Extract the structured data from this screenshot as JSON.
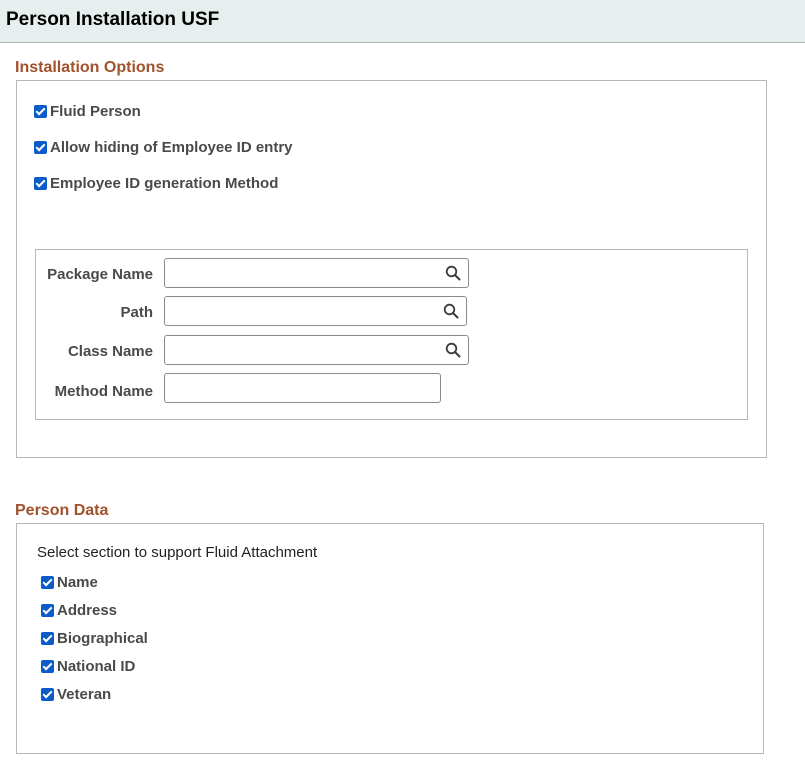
{
  "page": {
    "title": "Person Installation USF"
  },
  "installation_options": {
    "title": "Installation Options",
    "checkboxes": [
      {
        "label": "Fluid Person",
        "checked": true
      },
      {
        "label": "Allow hiding of Employee ID entry",
        "checked": true
      },
      {
        "label": "Employee ID generation Method",
        "checked": true
      }
    ],
    "fields": {
      "package_name": {
        "label": "Package Name",
        "value": ""
      },
      "path": {
        "label": "Path",
        "value": ""
      },
      "class_name": {
        "label": "Class Name",
        "value": ""
      },
      "method_name": {
        "label": "Method Name",
        "value": ""
      }
    }
  },
  "person_data": {
    "title": "Person Data",
    "instruction": "Select section to support Fluid Attachment",
    "checkboxes": [
      {
        "label": "Name",
        "checked": true
      },
      {
        "label": "Address",
        "checked": true
      },
      {
        "label": "Biographical",
        "checked": true
      },
      {
        "label": "National ID",
        "checked": true
      },
      {
        "label": "Veteran",
        "checked": true
      }
    ]
  },
  "colors": {
    "header_bg": "#e6eeee",
    "section_title": "#a0522d",
    "checkbox": "#0b5cc8"
  }
}
